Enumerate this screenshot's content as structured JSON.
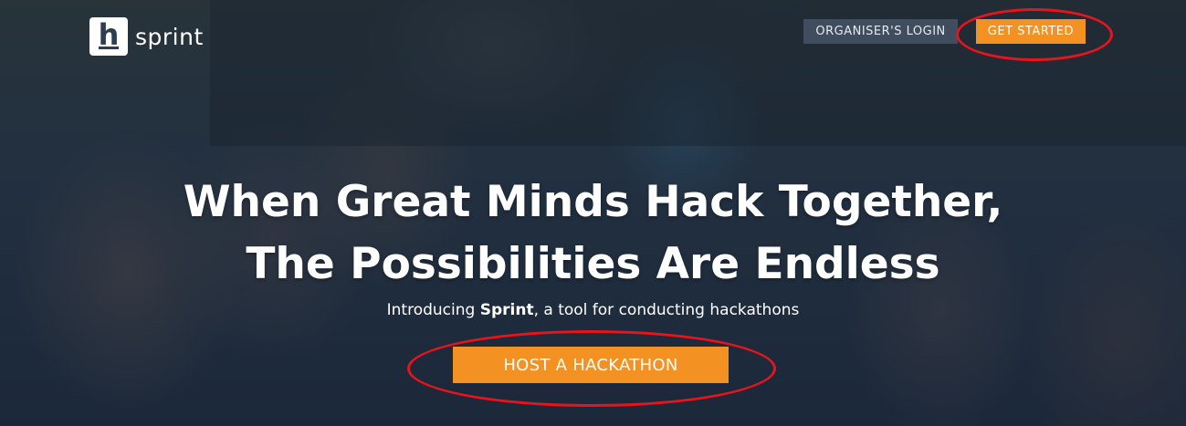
{
  "brand": {
    "logo_letter": "h",
    "name": "sprint"
  },
  "nav": {
    "login_label": "ORGANISER'S LOGIN",
    "start_label": "GET STARTED"
  },
  "hero": {
    "headline_line1": "When Great Minds Hack Together,",
    "headline_line2": "The Possibilities Are Endless",
    "sub_prefix": "Introducing ",
    "sub_bold": "Sprint",
    "sub_suffix": ", a tool for conducting hackathons",
    "cta_label": "HOST A HACKATHON"
  },
  "colors": {
    "accent": "#f39223",
    "annotation": "#e8141b",
    "overlay": "#14203a"
  }
}
